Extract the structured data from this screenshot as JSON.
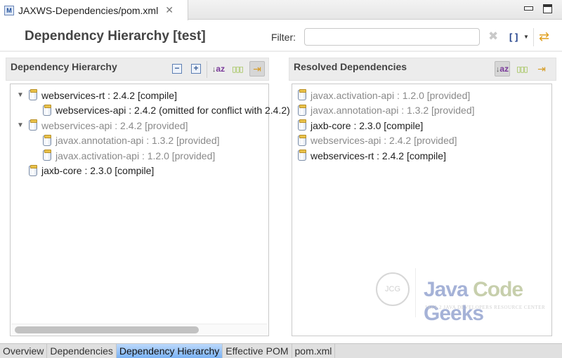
{
  "editor": {
    "tab_label": "JAXWS-Dependencies/pom.xml",
    "tab_icon": "maven-pom-icon",
    "maven_icon_letter": "M",
    "close_glyph": "✕"
  },
  "window_controls": {
    "minimize": "minimize-icon",
    "maximize": "maximize-icon"
  },
  "form": {
    "title": "Dependency Hierarchy [test]",
    "filter_label": "Filter:",
    "filter_value": "",
    "filter_placeholder": "",
    "clear_glyph": "✖",
    "brackets_glyph": "[ ]",
    "dropdown_glyph": "▼",
    "refresh_glyph": "⇄"
  },
  "hierarchy": {
    "title": "Dependency Hierarchy",
    "toolbar": {
      "collapse_glyph": "−",
      "expand_glyph": "+",
      "sort_glyph": "↓",
      "sort_a": "a",
      "sort_z": "z",
      "columns_glyph": "▯▯▯",
      "link_glyph": "⇥"
    },
    "rows": [
      {
        "label": "webservices-rt : 2.4.2 [compile]",
        "level": 0,
        "expanded": true,
        "dim": false
      },
      {
        "label": "webservices-api : 2.4.2 (omitted for conflict with 2.4.2)",
        "level": 1,
        "expanded": null,
        "dim": false
      },
      {
        "label": "webservices-api : 2.4.2 [provided]",
        "level": 0,
        "expanded": true,
        "dim": true
      },
      {
        "label": "javax.annotation-api : 1.3.2 [provided]",
        "level": 1,
        "expanded": null,
        "dim": true
      },
      {
        "label": "javax.activation-api : 1.2.0 [provided]",
        "level": 1,
        "expanded": null,
        "dim": true
      },
      {
        "label": "jaxb-core : 2.3.0 [compile]",
        "level": 0,
        "expanded": null,
        "dim": false
      }
    ],
    "horizontal_scroll_fraction": 0.72
  },
  "resolved": {
    "title": "Resolved Dependencies",
    "rows": [
      {
        "label": "javax.activation-api : 1.2.0 [provided]",
        "dim": true
      },
      {
        "label": "javax.annotation-api : 1.3.2 [provided]",
        "dim": true
      },
      {
        "label": "jaxb-core : 2.3.0 [compile]",
        "dim": false
      },
      {
        "label": "webservices-api : 2.4.2 [provided]",
        "dim": true
      },
      {
        "label": "webservices-rt : 2.4.2 [compile]",
        "dim": false
      }
    ]
  },
  "watermark": {
    "logo_text": "JCG",
    "title_java": "Java ",
    "title_code": "Code",
    "title_geeks": " Geeks",
    "subtitle": "JAVA 2 JAVA DEVELOPERS RESOURCE CENTER"
  },
  "page_tabs": [
    {
      "label": "Overview",
      "active": false
    },
    {
      "label": "Dependencies",
      "active": false
    },
    {
      "label": "Dependency Hierarchy",
      "active": true
    },
    {
      "label": "Effective POM",
      "active": false
    },
    {
      "label": "pom.xml",
      "active": false
    }
  ]
}
